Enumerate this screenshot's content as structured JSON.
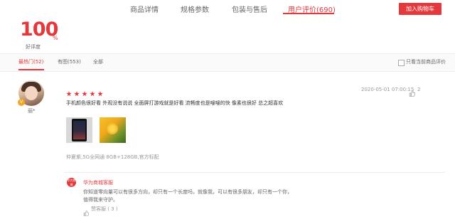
{
  "tabs": [
    {
      "label": "商品详情"
    },
    {
      "label": "规格参数"
    },
    {
      "label": "包装与售后"
    },
    {
      "label": "用户评价(690)"
    }
  ],
  "cart_button": "加入购物车",
  "rating": {
    "value": "100",
    "unit": "%",
    "label": "好评度"
  },
  "filters": [
    {
      "label": "最热门(52)"
    },
    {
      "label": "有图(553)"
    },
    {
      "label": "全部"
    }
  ],
  "only_current_label": "只看当前商品评价",
  "review": {
    "username": "丽*",
    "badge": "V",
    "stars": 5,
    "datetime": "2020-05-01 07:00:15",
    "likes": "2",
    "text": "手机颜色很好看 外观没有说说 全面屏打游戏就是好看 流畅度也是嗖嗖的快 像素也很好 总之超喜欢",
    "spec": "仲夏紫,5G全网通 8GB+128GB,官方标配",
    "reply": {
      "logo": "华为商城",
      "name": "华为商城客服",
      "text": "你知道零向量可以有很多方向，却只有一个长度吗，就像我，可以有很多朋友，却只有一个你，值得我来守护。",
      "like_label": "赞客服 ( 3 )"
    }
  },
  "colors": {
    "accent": "#e4393c",
    "muted": "#999999"
  },
  "icons": {
    "like": "thumbs-up-icon"
  }
}
